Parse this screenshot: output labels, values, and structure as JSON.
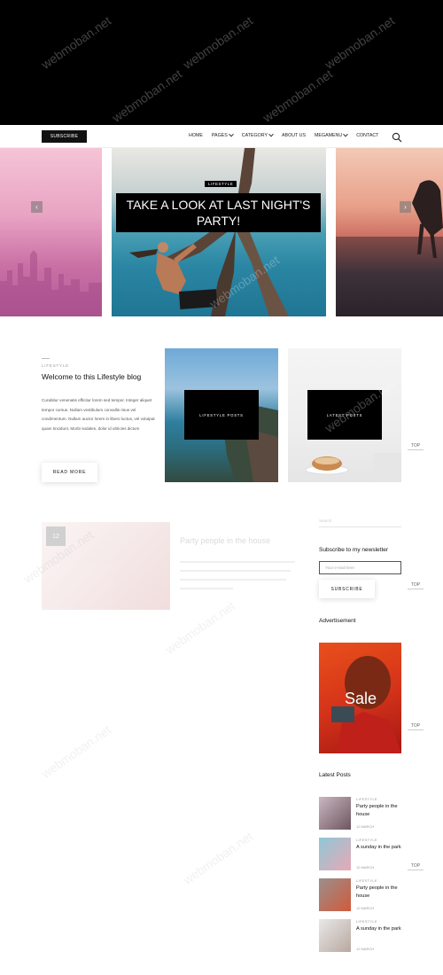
{
  "nav": {
    "subscribe_label": "SUBSCRIBE",
    "items": [
      {
        "label": "HOME",
        "dropdown": false
      },
      {
        "label": "PAGES",
        "dropdown": true
      },
      {
        "label": "CATEGORY",
        "dropdown": true
      },
      {
        "label": "ABOUT US",
        "dropdown": false
      },
      {
        "label": "MEGAMENU",
        "dropdown": true
      },
      {
        "label": "CONTACT",
        "dropdown": false
      }
    ],
    "search_icon": "search-icon"
  },
  "slider": {
    "tag": "LIFESTYLE",
    "title": "TAKE A LOOK AT LAST NIGHT'S PARTY!",
    "prev_icon": "chevron-left-icon",
    "next_icon": "chevron-right-icon"
  },
  "intro": {
    "category": "LIFESTYLE",
    "title": "Welcome to this Lifestyle blog",
    "text": "Curabitur venenatis efficitur lorem sed tempor. Integer aliquet tempor cursus. Nullam vestibulum convallis risus vel condimentum. Nullam auctor lorem in libero luctus, vel volutpat quam tincidunt. Morbi sodales, dolor id ultricies dictum",
    "read_more": "READ MORE"
  },
  "cards": [
    {
      "label": "LIFESTYLE POSTS"
    },
    {
      "label": "LATEST POSTS"
    }
  ],
  "top_link": "TOP",
  "faded_post": {
    "date": "12",
    "title": "Party people in the house"
  },
  "sidebar": {
    "search_placeholder": "Search",
    "newsletter_heading": "Subscribe to my newsletter",
    "email_placeholder": "Your e-mail here",
    "subscribe_label": "SUBSCRIBE",
    "ad_heading": "Advertisement",
    "ad_text": "Sale",
    "latest_heading": "Latest Posts",
    "latest_posts": [
      {
        "category": "LIFESTYLE",
        "title": "Party people in the house",
        "date": "12 MARCH"
      },
      {
        "category": "LIFESTYLE",
        "title": "A sunday in the park",
        "date": "12 MARCH"
      },
      {
        "category": "LIFESTYLE",
        "title": "Party people in the house",
        "date": "12 MARCH"
      },
      {
        "category": "LIFESTYLE",
        "title": "A sunday in the park",
        "date": "12 MARCH"
      }
    ]
  },
  "watermark": "webmoban.net"
}
